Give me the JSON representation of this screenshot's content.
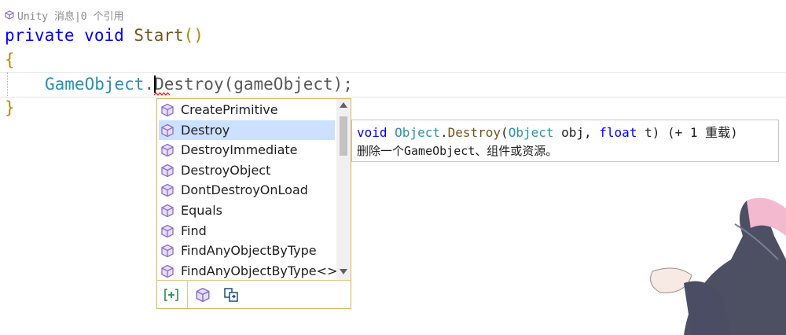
{
  "editor": {
    "codelens": "Unity 消息|0 个引用",
    "line1": {
      "kw1": "private",
      "kw2": "void",
      "fn": "Start",
      "parens": "()"
    },
    "line2": {
      "brace": "{"
    },
    "line3": {
      "type": "GameObject",
      "dot": ".",
      "text": "Destroy(gameObject);"
    },
    "line4": {
      "brace": "}"
    }
  },
  "completion": {
    "items": [
      {
        "label": "CreatePrimitive",
        "icon": "method-cube-icon"
      },
      {
        "label": "Destroy",
        "icon": "method-cube-icon",
        "selected": true
      },
      {
        "label": "DestroyImmediate",
        "icon": "method-cube-icon"
      },
      {
        "label": "DestroyObject",
        "icon": "method-cube-icon"
      },
      {
        "label": "DontDestroyOnLoad",
        "icon": "method-cube-icon"
      },
      {
        "label": "Equals",
        "icon": "method-cube-icon"
      },
      {
        "label": "Find",
        "icon": "method-cube-icon"
      },
      {
        "label": "FindAnyObjectByType",
        "icon": "method-cube-icon"
      },
      {
        "label": "FindAnyObjectByType<>",
        "icon": "method-cube-icon"
      }
    ],
    "toolbar": [
      "add-bracket-icon",
      "method-filter-icon",
      "extension-filter-icon"
    ]
  },
  "tooltip": {
    "kw_void": "void",
    "type_object": "Object",
    "dot": ".",
    "fn_destroy": "Destroy",
    "open": "(",
    "type_param": "Object",
    "param_obj": " obj, ",
    "kw_float": "float",
    "rest": " t) (+ 1 重载)",
    "description": "删除一个GameObject、组件或资源。"
  },
  "colors": {
    "keyword": "#0000ff",
    "type": "#2b91af",
    "method": "#74531f",
    "selection": "#cce0ff",
    "popup_border": "#d7b35c"
  }
}
